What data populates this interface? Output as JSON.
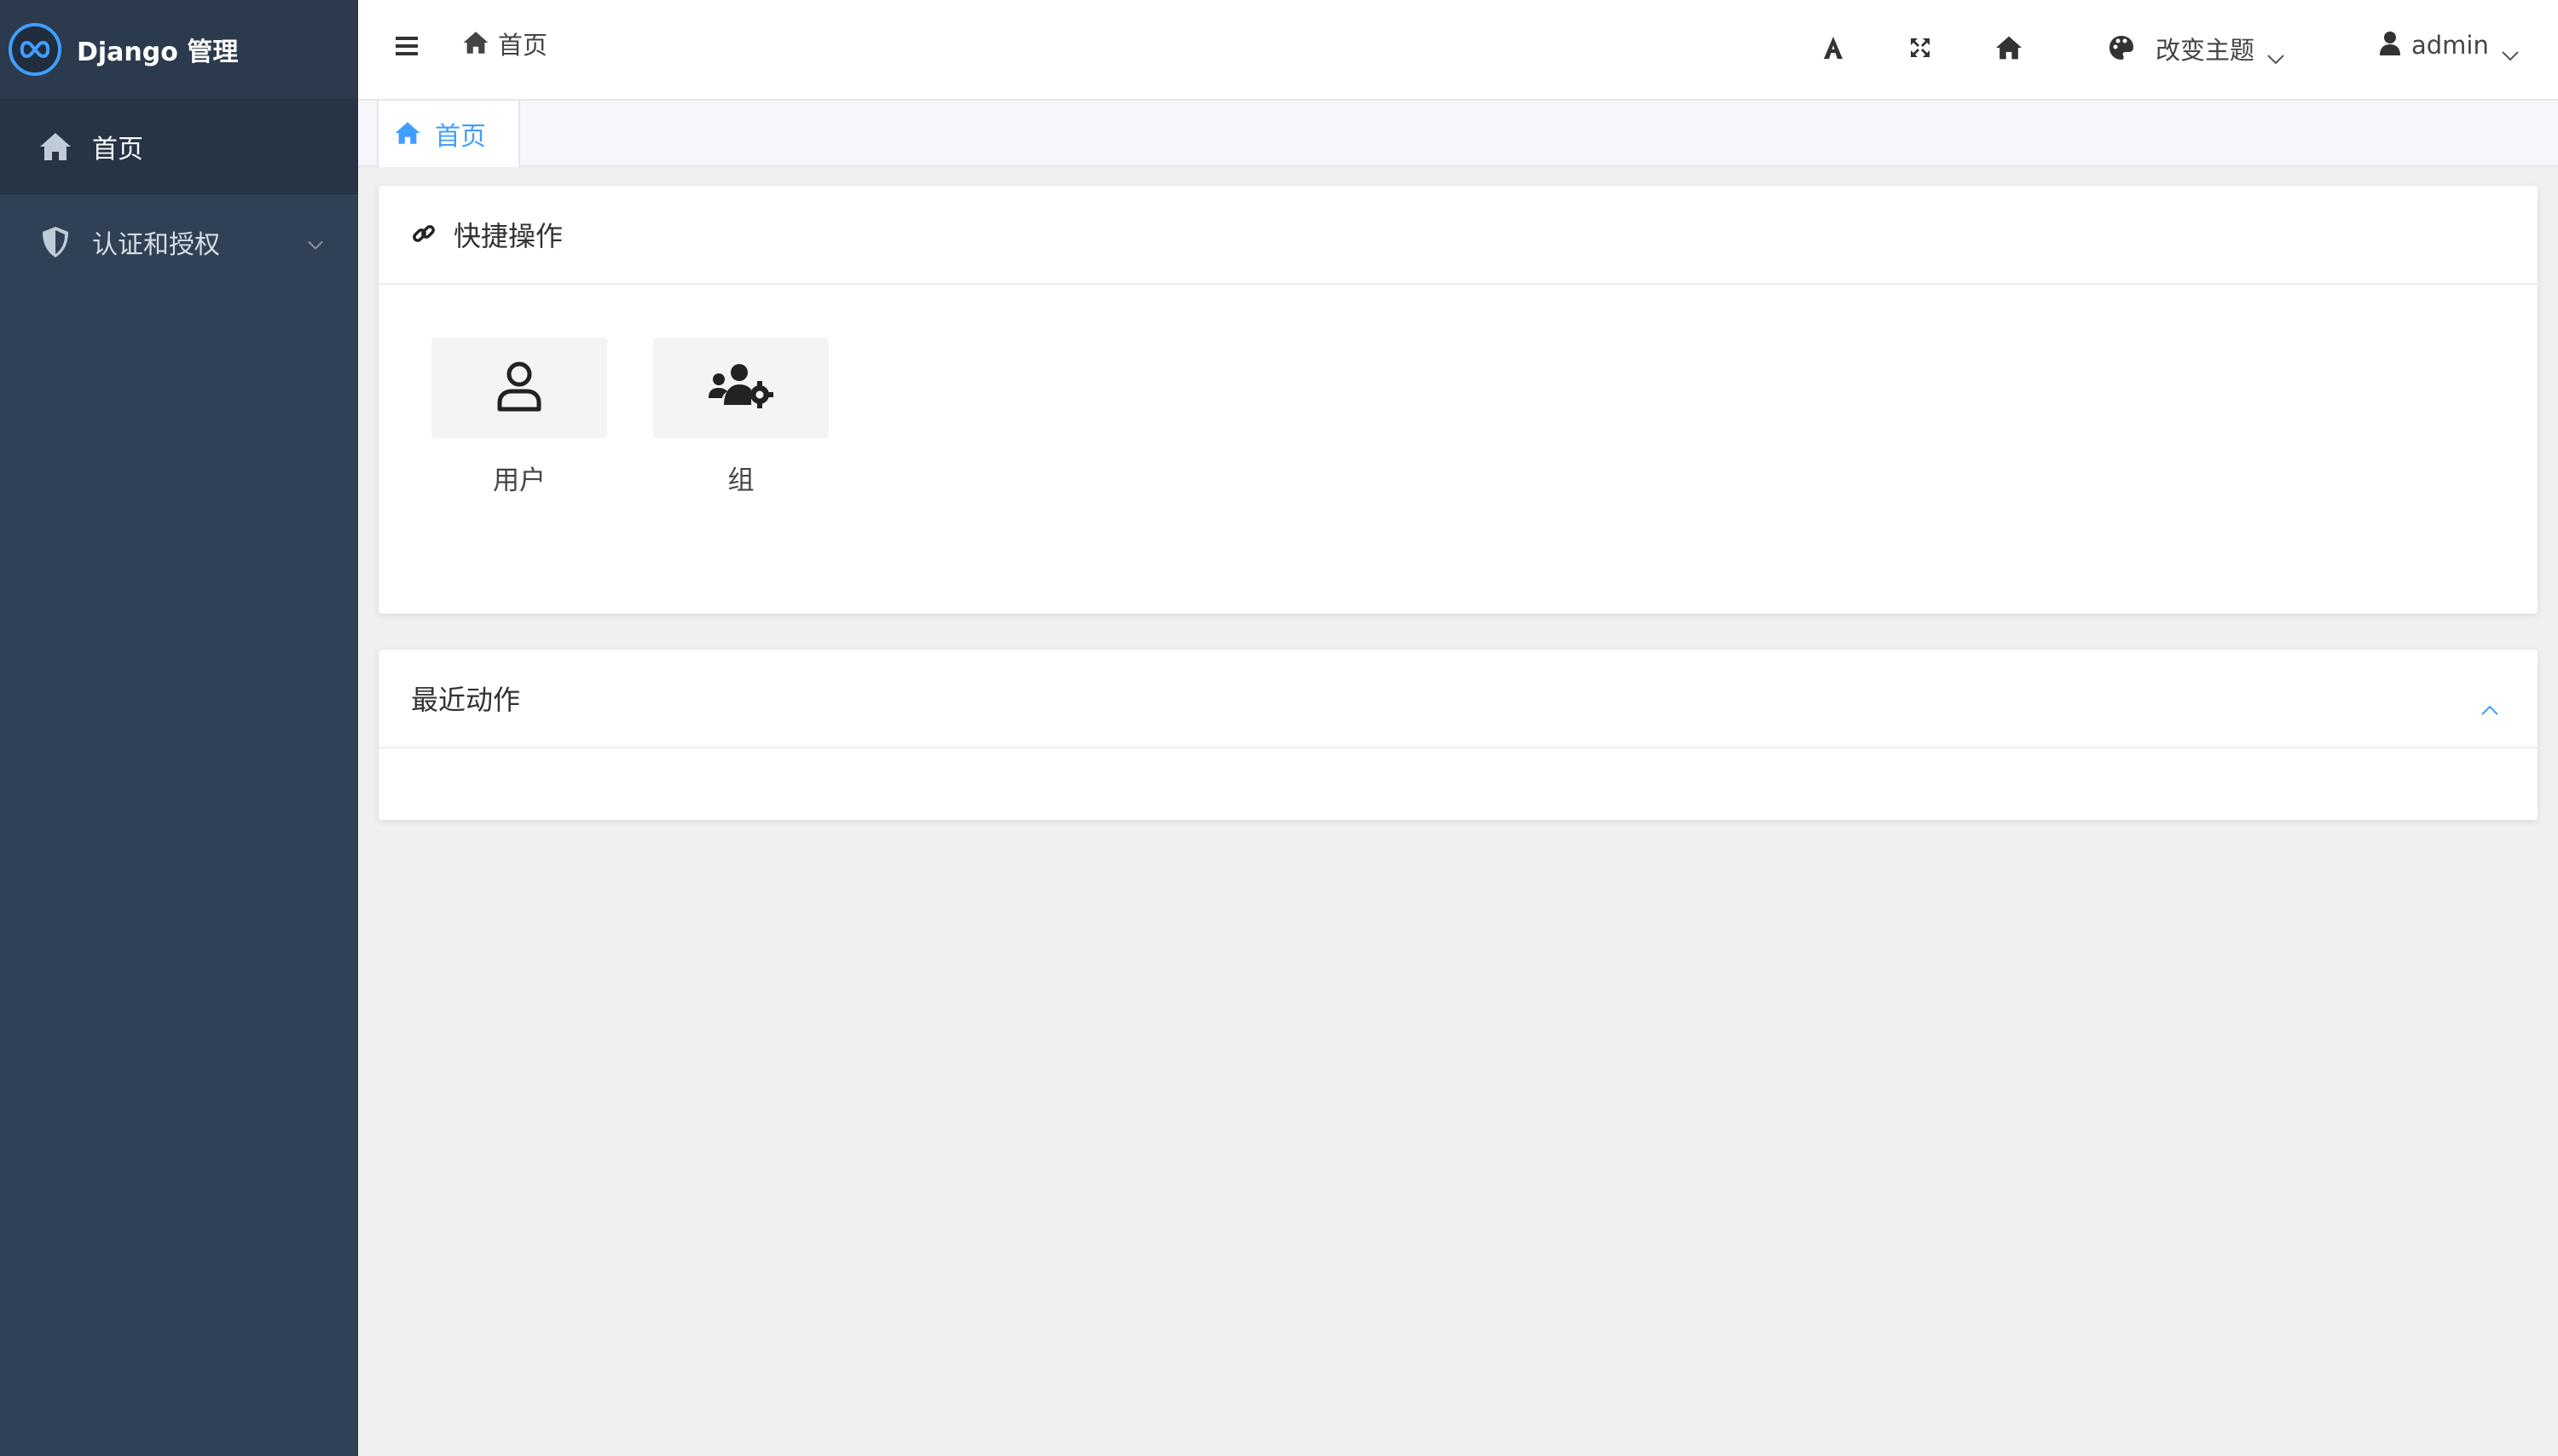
{
  "app": {
    "title": "Django 管理"
  },
  "colors": {
    "sidebar_bg": "#304156",
    "accent": "#409eff",
    "page_bg": "#f0f0f0"
  },
  "sidebar": {
    "items": [
      {
        "label": "首页",
        "icon": "home-icon",
        "active": true
      },
      {
        "label": "认证和授权",
        "icon": "shield-icon",
        "expandable": true
      }
    ]
  },
  "header": {
    "breadcrumb": "首页",
    "icons": [
      "font-size-icon",
      "fullscreen-icon",
      "home-icon"
    ],
    "theme_label": "改变主题",
    "user_label": "admin"
  },
  "tabs": [
    {
      "label": "首页",
      "active": true
    }
  ],
  "quick_actions": {
    "title": "快捷操作",
    "items": [
      {
        "label": "用户",
        "icon": "user-icon"
      },
      {
        "label": "组",
        "icon": "users-cog-icon"
      }
    ]
  },
  "recent_actions": {
    "title": "最近动作"
  }
}
